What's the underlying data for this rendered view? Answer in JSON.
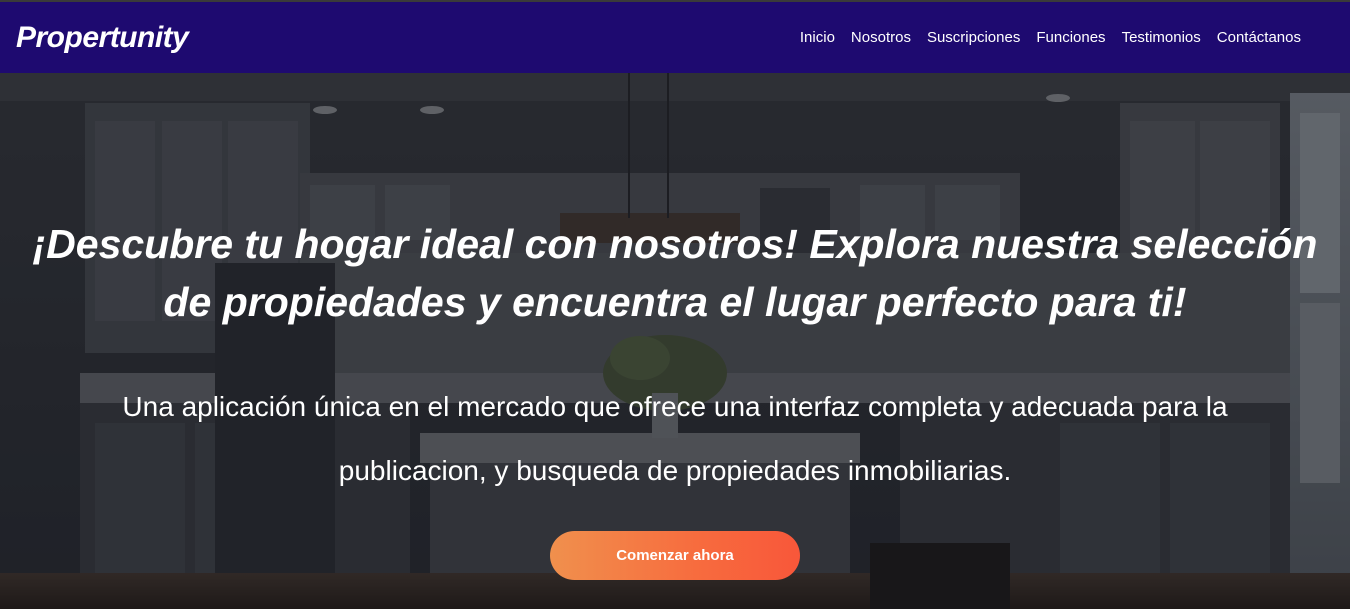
{
  "navbar": {
    "brand": "Propertunity",
    "links": [
      "Inicio",
      "Nosotros",
      "Suscripciones",
      "Funciones",
      "Testimonios",
      "Contáctanos"
    ],
    "background": "#1e0a70"
  },
  "hero": {
    "headline": "¡Descubre tu hogar ideal con nosotros! Explora nuestra selección de propiedades y encuentra el lugar perfecto para ti!",
    "subtitle": "Una aplicación única en el mercado que ofrece una interfaz completa y adecuada para la publicacion, y busqueda de propiedades inmobiliarias.",
    "cta_label": "Comenzar ahora",
    "cta_colors": [
      "#f0904d",
      "#f8573a"
    ]
  }
}
